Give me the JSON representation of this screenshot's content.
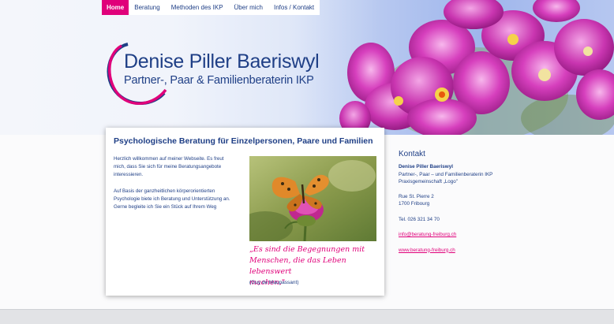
{
  "nav": {
    "tabs": [
      {
        "label": "Home",
        "active": true
      },
      {
        "label": "Beratung",
        "active": false
      },
      {
        "label": "Methoden des IKP",
        "active": false
      },
      {
        "label": "Über mich",
        "active": false
      },
      {
        "label": "Infos / Kontakt",
        "active": false
      }
    ]
  },
  "header": {
    "name": "Denise Piller Baeriswyl",
    "subtitle": "Partner-, Paar & Familienberaterin IKP"
  },
  "main": {
    "title": "Psychologische Beratung für Einzelpersonen, Paare und Familien",
    "intro_lines": [
      "Herzlich willkommen auf meiner Webseite. Es freut",
      "mich, dass Sie sich für meine Beratungsangebote",
      "interessieren."
    ],
    "intro2_lines": [
      "Auf Basis der ganzheitlichen körperorientierten",
      "Psychologie biete ich Beratung und Unterstützung an.",
      "Gerne begleite ich Sie ein Stück auf Ihrem Weg"
    ],
    "quote_lines": [
      "„Es sind die Begegnungen mit",
      "Menschen, die das Leben lebenswert",
      "machen.\""
    ],
    "quote_author": "(Guy de Maupassant)"
  },
  "contact": {
    "heading": "Kontakt",
    "name": "Denise Piller Baeriswyl",
    "role": "Partner-, Paar – und Familienberaterin IKP",
    "practice": "Praxisgemeinschaft „Logo\"",
    "street": "Rue St. Pierre 2",
    "city": "1700 Fribourg",
    "phone": "Tel. 026 321 34 70",
    "email": "info@beratung-freiburg.ch",
    "website": "www.beratung-freiburg.ch"
  },
  "colors": {
    "accent": "#e0007a",
    "text": "#1f3f86"
  }
}
